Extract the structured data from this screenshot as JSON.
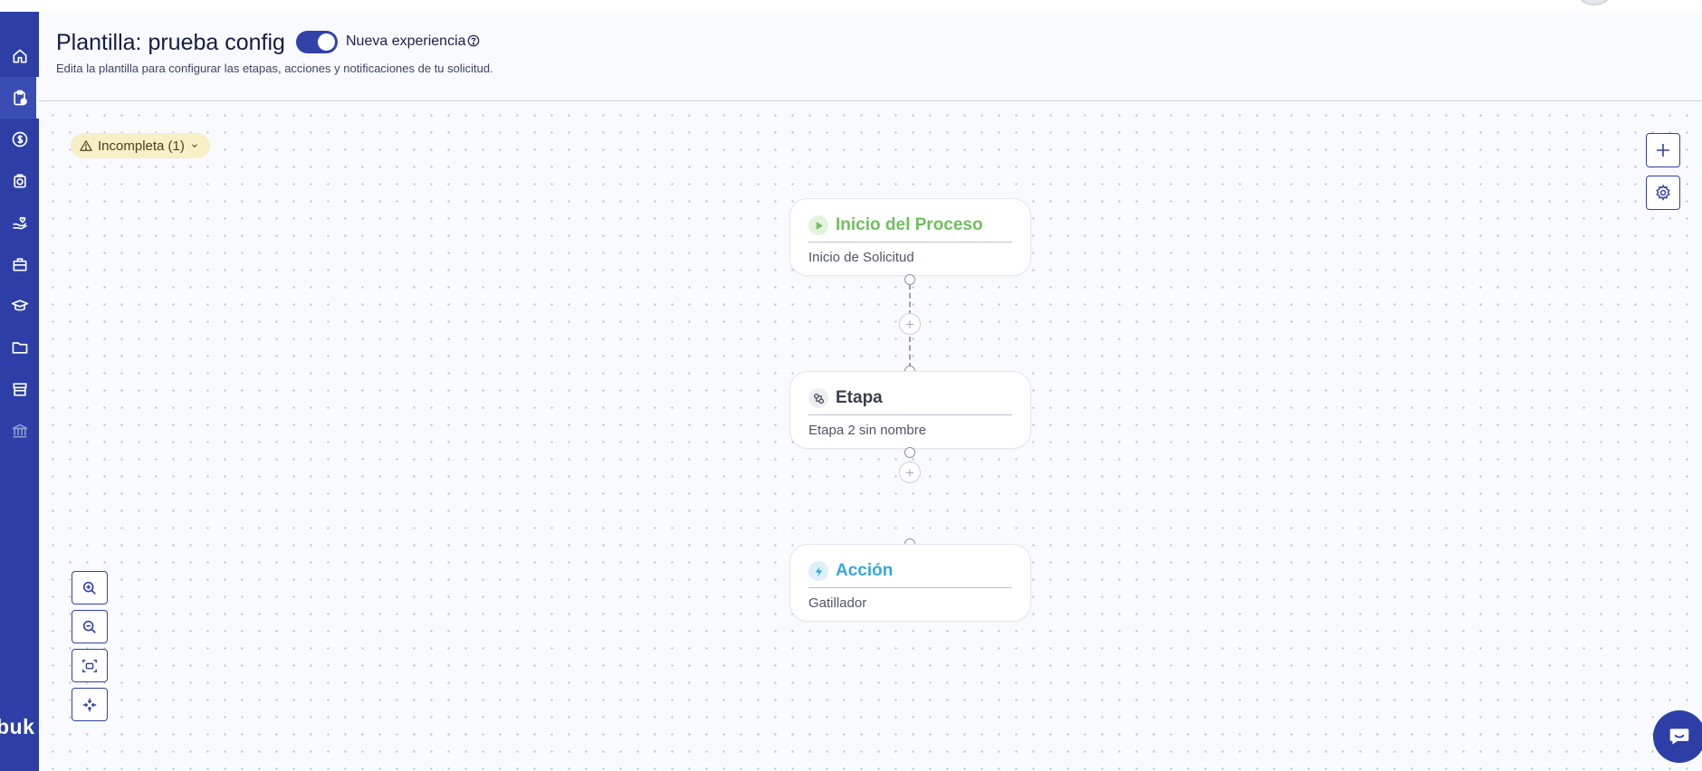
{
  "header": {
    "title": "Plantilla: prueba config",
    "toggle_label": "Nueva experiencia",
    "subtitle": "Edita la plantilla para configurar las etapas, acciones y notificaciones de tu solicitud."
  },
  "sidebar": {
    "logo_text": "buk",
    "items": [
      {
        "icon": "home-icon"
      },
      {
        "icon": "clipboard-icon",
        "active": true
      },
      {
        "icon": "dollar-icon"
      },
      {
        "icon": "lifebuoy-icon"
      },
      {
        "icon": "hand-heart-icon"
      },
      {
        "icon": "briefcase-icon"
      },
      {
        "icon": "graduation-cap-icon"
      },
      {
        "icon": "folder-icon"
      },
      {
        "icon": "store-icon"
      },
      {
        "icon": "bank-icon"
      }
    ]
  },
  "canvas": {
    "status_badge": "Incompleta (1)",
    "nodes": [
      {
        "title": "Inicio del Proceso",
        "subtitle": "Inicio de Solicitud",
        "icon": "play-icon",
        "color": "#6fbf5e"
      },
      {
        "title": "Etapa",
        "subtitle": "Etapa 2 sin nombre",
        "icon": "stage-icon",
        "color": "#3a3f4c"
      },
      {
        "title": "Acción",
        "subtitle": "Gatillador",
        "icon": "lightning-icon",
        "color": "#3aa6d9"
      }
    ]
  },
  "colors": {
    "brand": "#2d3fa6",
    "badge_bg": "#f7efc6",
    "start_green": "#6fbf5e",
    "action_blue": "#3aa6d9"
  }
}
